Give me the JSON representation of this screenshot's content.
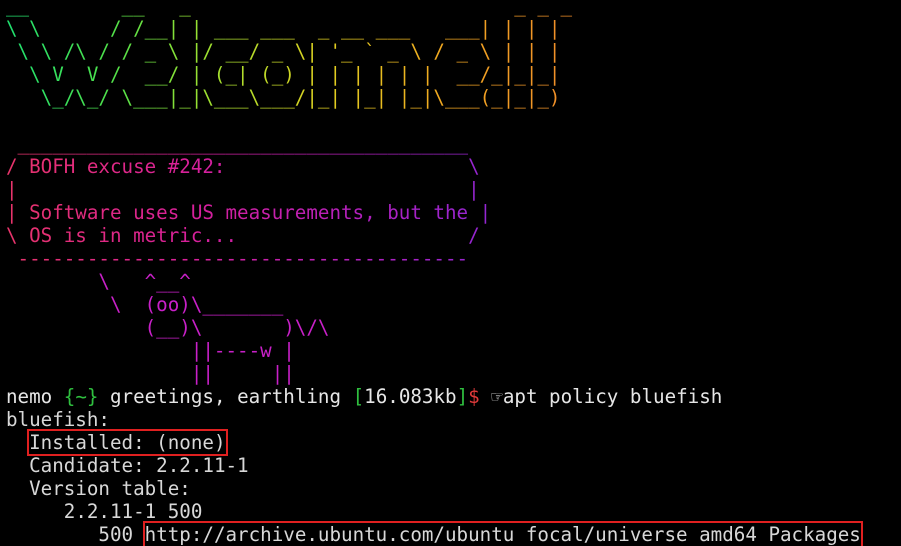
{
  "welcome_art": [
    "__        __   _                            _ _ _ ",
    "\\ \\      / /__| | ___ ___  _ __ ___   ___| | | |",
    " \\ \\ /\\ / / _ \\ |/ __/ _ \\| '_ ` _ \\ / _ \\ | | |",
    "  \\ V  V /  __/ | (_| (_) | | | | | |  __/_|_|_|",
    "   \\_/\\_/ \\___|_|\\___\\___/|_| |_| |_|\\___(_|_|_)"
  ],
  "cowsay": {
    "bubble": [
      " _______________________________________",
      "/ BOFH excuse #242:                     \\",
      "|                                       |",
      "| Software uses US measurements, but the |",
      "\\ OS is in metric...                    /",
      " ---------------------------------------"
    ],
    "cow": [
      "        \\   ^__^",
      "         \\  (oo)\\_______",
      "            (__)\\       )\\/\\",
      "                ||----w |",
      "                ||     ||"
    ]
  },
  "prompt": {
    "user": "nemo",
    "dir": "{~}",
    "greeting": "greetings, earthling",
    "size_open": "[",
    "size": "16.083kb",
    "size_close": "]",
    "dollar": "$",
    "hand": "☞",
    "command": "apt policy bluefish"
  },
  "output": {
    "package": "bluefish:",
    "installed": "Installed: (none)",
    "candidate": "Candidate: 2.2.11-1",
    "version_table": "Version table:",
    "version_entry": "2.2.11-1 500",
    "priority": "500",
    "source": "http://archive.ubuntu.com/ubuntu focal/universe amd64 Packages"
  },
  "colors": {
    "background": "#000000",
    "prompt_green": "#2fbf3f",
    "dollar_red": "#e03a3a",
    "highlight_red": "#e02020",
    "cow_magenta": "#c820c8"
  }
}
